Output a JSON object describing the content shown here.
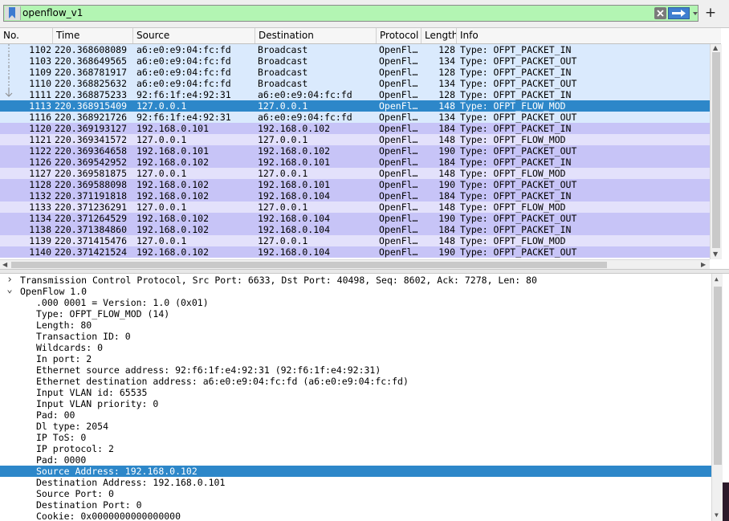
{
  "filter": {
    "value": "openflow_v1"
  },
  "columns": [
    "No.",
    "Time",
    "Source",
    "Destination",
    "Protocol",
    "Length",
    "Info"
  ],
  "colors": {
    "selected": "#2d87c9",
    "row_light_blue": "#daeafd",
    "row_lavender": "#c7c4f7",
    "row_pale_lavender": "#e3e1fb",
    "filter_valid": "#b3f5b3"
  },
  "packets": [
    {
      "no": "1102",
      "time": "220.368608089",
      "src": "a6:e0:e9:04:fc:fd",
      "dst": "Broadcast",
      "proto": "OpenFl…",
      "len": "128",
      "info": "Type: OFPT_PACKET_IN",
      "color": "row_light_blue"
    },
    {
      "no": "1103",
      "time": "220.368649565",
      "src": "a6:e0:e9:04:fc:fd",
      "dst": "Broadcast",
      "proto": "OpenFl…",
      "len": "134",
      "info": "Type: OFPT_PACKET_OUT",
      "color": "row_light_blue"
    },
    {
      "no": "1109",
      "time": "220.368781917",
      "src": "a6:e0:e9:04:fc:fd",
      "dst": "Broadcast",
      "proto": "OpenFl…",
      "len": "128",
      "info": "Type: OFPT_PACKET_IN",
      "color": "row_light_blue"
    },
    {
      "no": "1110",
      "time": "220.368825632",
      "src": "a6:e0:e9:04:fc:fd",
      "dst": "Broadcast",
      "proto": "OpenFl…",
      "len": "134",
      "info": "Type: OFPT_PACKET_OUT",
      "color": "row_light_blue"
    },
    {
      "no": "1111",
      "time": "220.368875233",
      "src": "92:f6:1f:e4:92:31",
      "dst": "a6:e0:e9:04:fc:fd",
      "proto": "OpenFl…",
      "len": "128",
      "info": "Type: OFPT_PACKET_IN",
      "color": "row_light_blue"
    },
    {
      "no": "1113",
      "time": "220.368915409",
      "src": "127.0.0.1",
      "dst": "127.0.0.1",
      "proto": "OpenFl…",
      "len": "148",
      "info": "Type: OFPT_FLOW_MOD",
      "color": "selected"
    },
    {
      "no": "1116",
      "time": "220.368921726",
      "src": "92:f6:1f:e4:92:31",
      "dst": "a6:e0:e9:04:fc:fd",
      "proto": "OpenFl…",
      "len": "134",
      "info": "Type: OFPT_PACKET_OUT",
      "color": "row_light_blue"
    },
    {
      "no": "1120",
      "time": "220.369193127",
      "src": "192.168.0.101",
      "dst": "192.168.0.102",
      "proto": "OpenFl…",
      "len": "184",
      "info": "Type: OFPT_PACKET_IN",
      "color": "row_lavender"
    },
    {
      "no": "1121",
      "time": "220.369341572",
      "src": "127.0.0.1",
      "dst": "127.0.0.1",
      "proto": "OpenFl…",
      "len": "148",
      "info": "Type: OFPT_FLOW_MOD",
      "color": "row_pale_lavender"
    },
    {
      "no": "1122",
      "time": "220.369364658",
      "src": "192.168.0.101",
      "dst": "192.168.0.102",
      "proto": "OpenFl…",
      "len": "190",
      "info": "Type: OFPT_PACKET_OUT",
      "color": "row_lavender"
    },
    {
      "no": "1126",
      "time": "220.369542952",
      "src": "192.168.0.102",
      "dst": "192.168.0.101",
      "proto": "OpenFl…",
      "len": "184",
      "info": "Type: OFPT_PACKET_IN",
      "color": "row_lavender"
    },
    {
      "no": "1127",
      "time": "220.369581875",
      "src": "127.0.0.1",
      "dst": "127.0.0.1",
      "proto": "OpenFl…",
      "len": "148",
      "info": "Type: OFPT_FLOW_MOD",
      "color": "row_pale_lavender"
    },
    {
      "no": "1128",
      "time": "220.369588098",
      "src": "192.168.0.102",
      "dst": "192.168.0.101",
      "proto": "OpenFl…",
      "len": "190",
      "info": "Type: OFPT_PACKET_OUT",
      "color": "row_lavender"
    },
    {
      "no": "1132",
      "time": "220.371191818",
      "src": "192.168.0.102",
      "dst": "192.168.0.104",
      "proto": "OpenFl…",
      "len": "184",
      "info": "Type: OFPT_PACKET_IN",
      "color": "row_lavender"
    },
    {
      "no": "1133",
      "time": "220.371236291",
      "src": "127.0.0.1",
      "dst": "127.0.0.1",
      "proto": "OpenFl…",
      "len": "148",
      "info": "Type: OFPT_FLOW_MOD",
      "color": "row_pale_lavender"
    },
    {
      "no": "1134",
      "time": "220.371264529",
      "src": "192.168.0.102",
      "dst": "192.168.0.104",
      "proto": "OpenFl…",
      "len": "190",
      "info": "Type: OFPT_PACKET_OUT",
      "color": "row_lavender"
    },
    {
      "no": "1138",
      "time": "220.371384860",
      "src": "192.168.0.102",
      "dst": "192.168.0.104",
      "proto": "OpenFl…",
      "len": "184",
      "info": "Type: OFPT_PACKET_IN",
      "color": "row_lavender"
    },
    {
      "no": "1139",
      "time": "220.371415476",
      "src": "127.0.0.1",
      "dst": "127.0.0.1",
      "proto": "OpenFl…",
      "len": "148",
      "info": "Type: OFPT_FLOW_MOD",
      "color": "row_pale_lavender"
    },
    {
      "no": "1140",
      "time": "220.371421524",
      "src": "192.168.0.102",
      "dst": "192.168.0.104",
      "proto": "OpenFl…",
      "len": "190",
      "info": "Type: OFPT_PACKET_OUT",
      "color": "row_lavender"
    }
  ],
  "details": [
    {
      "text": "Transmission Control Protocol, Src Port: 6633, Dst Port: 40498, Seq: 8602, Ack: 7278, Len: 80",
      "level": 0,
      "toggle": "collapsed"
    },
    {
      "text": "OpenFlow 1.0",
      "level": 0,
      "toggle": "expanded"
    },
    {
      "text": ".000 0001 = Version: 1.0 (0x01)",
      "level": 1
    },
    {
      "text": "Type: OFPT_FLOW_MOD (14)",
      "level": 1
    },
    {
      "text": "Length: 80",
      "level": 1
    },
    {
      "text": "Transaction ID: 0",
      "level": 1
    },
    {
      "text": "Wildcards: 0",
      "level": 1
    },
    {
      "text": "In port: 2",
      "level": 1
    },
    {
      "text": "Ethernet source address: 92:f6:1f:e4:92:31 (92:f6:1f:e4:92:31)",
      "level": 1
    },
    {
      "text": "Ethernet destination address: a6:e0:e9:04:fc:fd (a6:e0:e9:04:fc:fd)",
      "level": 1
    },
    {
      "text": "Input VLAN id: 65535",
      "level": 1
    },
    {
      "text": "Input VLAN priority: 0",
      "level": 1
    },
    {
      "text": "Pad: 00",
      "level": 1
    },
    {
      "text": "Dl type: 2054",
      "level": 1
    },
    {
      "text": "IP ToS: 0",
      "level": 1
    },
    {
      "text": "IP protocol: 2",
      "level": 1
    },
    {
      "text": "Pad: 0000",
      "level": 1
    },
    {
      "text": "Source Address: 192.168.0.102",
      "level": 1,
      "selected": true
    },
    {
      "text": "Destination Address: 192.168.0.101",
      "level": 1
    },
    {
      "text": "Source Port: 0",
      "level": 1
    },
    {
      "text": "Destination Port: 0",
      "level": 1
    },
    {
      "text": "Cookie: 0x0000000000000000",
      "level": 1
    }
  ]
}
